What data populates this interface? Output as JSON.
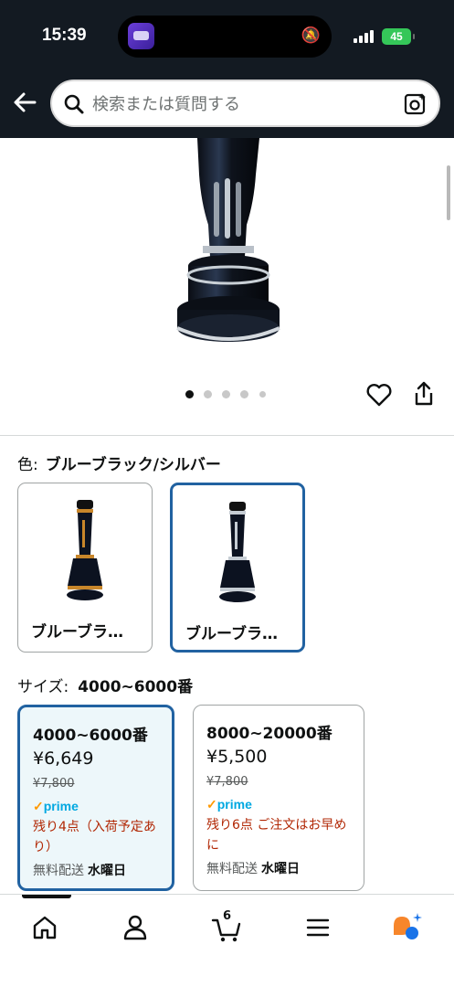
{
  "status_bar": {
    "time": "15:39",
    "battery": "45"
  },
  "header": {
    "search": {
      "placeholder": "検索または質問する"
    }
  },
  "gallery": {
    "image_count": 5,
    "active_index": 0
  },
  "variations": {
    "color": {
      "label": "色:",
      "selected_value": "ブルーブラック/シルバー",
      "options": [
        {
          "label": "ブルーブラ…"
        },
        {
          "label": "ブルーブラ…"
        }
      ]
    },
    "size": {
      "label": "サイズ:",
      "selected_value": "4000~6000番",
      "options": [
        {
          "name": "4000~6000番",
          "price": "¥6,649",
          "list_price": "¥7,800",
          "prime": "prime",
          "stock": "残り4点（入荷予定あり）",
          "shipping": "無料配送",
          "delivery_day": "水曜日"
        },
        {
          "name": "8000~20000番",
          "price": "¥5,500",
          "list_price": "¥7,800",
          "prime": "prime",
          "stock": "残り6点 ご注文はお早めに",
          "shipping": "無料配送",
          "delivery_day": "水曜日"
        }
      ]
    }
  },
  "bottom_nav": {
    "cart_count": "6"
  },
  "colors": {
    "header_bg": "#131a22",
    "selected_border": "#2162a1",
    "selected_bg": "#edf7fa",
    "stock_red": "#b12704",
    "prime_blue": "#00a8e1",
    "prime_orange": "#ff9900"
  }
}
